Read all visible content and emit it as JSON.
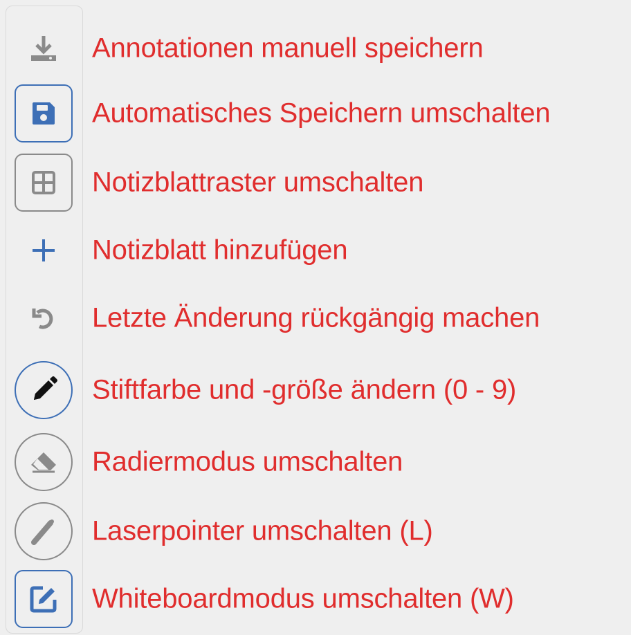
{
  "toolbar": {
    "items": [
      {
        "icon": "download-icon",
        "label": "Annotationen manuell speichern"
      },
      {
        "icon": "floppy-disk-icon",
        "label": "Automatisches Speichern umschalten"
      },
      {
        "icon": "grid-icon",
        "label": "Notizblattraster umschalten"
      },
      {
        "icon": "plus-icon",
        "label": "Notizblatt hinzufügen"
      },
      {
        "icon": "undo-icon",
        "label": "Letzte Änderung rückgängig machen"
      },
      {
        "icon": "pencil-icon",
        "label": "Stiftfarbe und -größe ändern (0 - 9)"
      },
      {
        "icon": "eraser-icon",
        "label": "Radiermodus umschalten"
      },
      {
        "icon": "laser-pointer-icon",
        "label": "Laserpointer umschalten (L)"
      },
      {
        "icon": "edit-square-icon",
        "label": "Whiteboardmodus umschalten (W)"
      }
    ]
  },
  "colors": {
    "label_red": "#e02d2d",
    "accent_blue": "#3d6fb6",
    "icon_gray": "#8a8a8a",
    "background": "#efefef"
  }
}
